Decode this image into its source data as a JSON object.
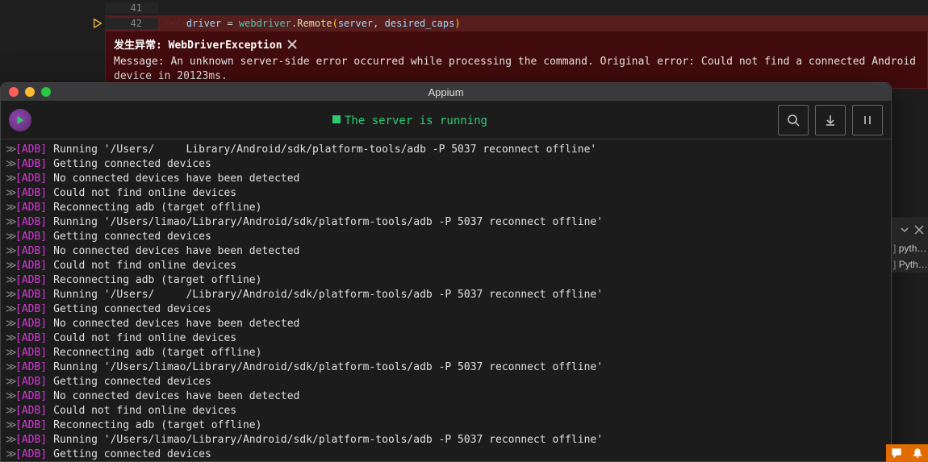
{
  "editor": {
    "lines": [
      {
        "num": "41",
        "content": ""
      },
      {
        "num": "42",
        "content": "    driver = webdriver.Remote(server, desired_caps)"
      }
    ],
    "line2_tokens": {
      "indent": "····",
      "var": "driver",
      "eq": " = ",
      "mod": "webdriver",
      "dot": ".",
      "fn": "Remote",
      "lp": "(",
      "arg1": "server",
      "comma": ", ",
      "arg2": "desired_caps",
      "rp": ")"
    }
  },
  "exception": {
    "title_prefix": "发生异常:",
    "title_kind": "WebDriverException",
    "message": "Message: An unknown server-side error occurred while processing the command. Original error: Could not find a connected Android device in 20123ms."
  },
  "appium": {
    "title": "Appium",
    "status": "The server is running",
    "log_source": "[ADB]",
    "logs": [
      "Running '/Users/     Library/Android/sdk/platform-tools/adb -P 5037 reconnect offline'",
      "Getting connected devices",
      "No connected devices have been detected",
      "Could not find online devices",
      "Reconnecting adb (target offline)",
      "Running '/Users/limao/Library/Android/sdk/platform-tools/adb -P 5037 reconnect offline'",
      "Getting connected devices",
      "No connected devices have been detected",
      "Could not find online devices",
      "Reconnecting adb (target offline)",
      "Running '/Users/     /Library/Android/sdk/platform-tools/adb -P 5037 reconnect offline'",
      "Getting connected devices",
      "No connected devices have been detected",
      "Could not find online devices",
      "Reconnecting adb (target offline)",
      "Running '/Users/limao/Library/Android/sdk/platform-tools/adb -P 5037 reconnect offline'",
      "Getting connected devices",
      "No connected devices have been detected",
      "Could not find online devices",
      "Reconnecting adb (target offline)",
      "Running '/Users/limao/Library/Android/sdk/platform-tools/adb -P 5037 reconnect offline'",
      "Getting connected devices"
    ]
  },
  "right_panel": {
    "items": [
      "pyth…",
      "Pyth…"
    ]
  }
}
